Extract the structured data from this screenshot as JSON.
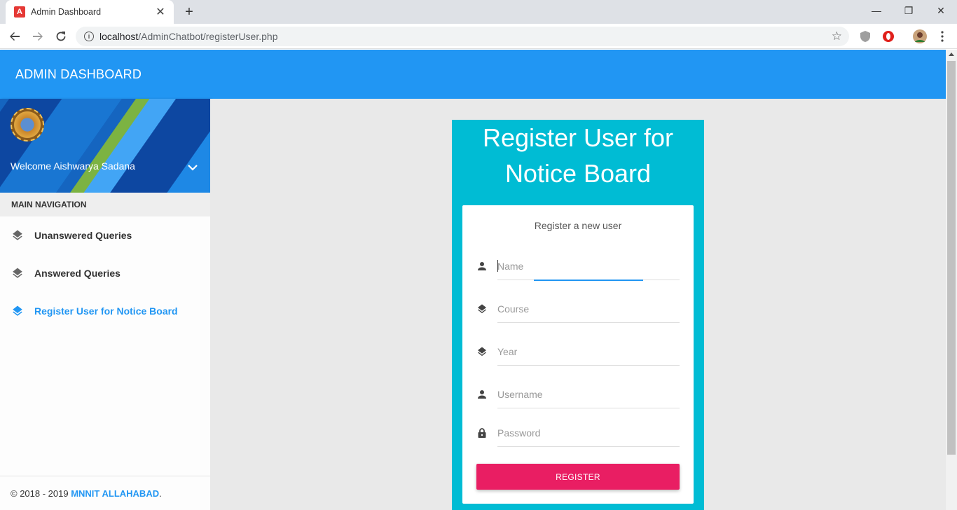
{
  "browser": {
    "tab_title": "Admin Dashboard",
    "favicon_letter": "A",
    "url_host": "localhost",
    "url_path": "/AdminChatbot/registerUser.php"
  },
  "app": {
    "title": "ADMIN DASHBOARD",
    "accent_color": "#2196f3"
  },
  "sidebar": {
    "welcome": "Welcome Aishwarya Sadana",
    "nav_header": "MAIN NAVIGATION",
    "items": [
      {
        "label": "Unanswered Queries",
        "icon": "layers-icon",
        "active": false
      },
      {
        "label": "Answered Queries",
        "icon": "layers-icon",
        "active": false
      },
      {
        "label": "Register User for Notice Board",
        "icon": "layers-icon",
        "active": true
      }
    ],
    "footer_prefix": "© 2018 - 2019 ",
    "footer_brand": "MNNIT ALLAHABAD",
    "footer_suffix": "."
  },
  "form": {
    "heading": "Register User for Notice Board",
    "message": "Register a new user",
    "fields": [
      {
        "placeholder": "Name",
        "icon": "person-icon",
        "value": ""
      },
      {
        "placeholder": "Course",
        "icon": "layers-icon",
        "value": ""
      },
      {
        "placeholder": "Year",
        "icon": "layers-icon",
        "value": ""
      },
      {
        "placeholder": "Username",
        "icon": "person-icon",
        "value": ""
      },
      {
        "placeholder": "Password",
        "icon": "lock-icon",
        "value": ""
      }
    ],
    "submit_label": "REGISTER",
    "card_color": "#00bcd4",
    "button_color": "#e91e63"
  }
}
